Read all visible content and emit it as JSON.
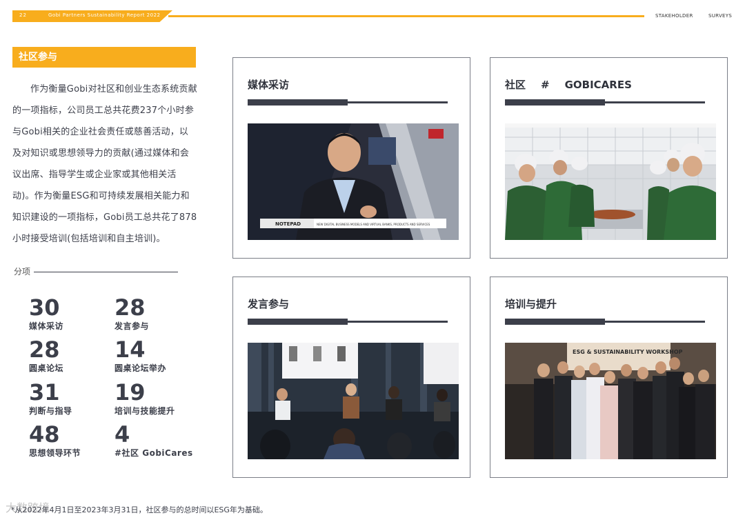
{
  "header": {
    "page_number": "22",
    "report_title": "Gobi Partners  Sustainability Report 2022",
    "nav": [
      "STAKEHOLDER",
      "SURVEYS"
    ],
    "accent_color": "#f8ad1d"
  },
  "section": {
    "title": "社区参与",
    "intro": "作为衡量Gobi对社区和创业生态系统贡献的一项指标，公司员工总共花费237个小时参与Gobi相关的企业社会责任或慈善活动，以及对知识或思想领导力的贡献(通过媒体和会议出席、指导学生或企业家或其他相关活动)。作为衡量ESG和可持续发展相关能力和知识建设的一项指标，Gobi员工总共花了878小时接受培训(包括培训和自主培训)。",
    "breakdown_label": "分项"
  },
  "stats": [
    {
      "value": "30",
      "label": "媒体采访"
    },
    {
      "value": "28",
      "label": "发言参与"
    },
    {
      "value": "28",
      "label": "圆桌论坛"
    },
    {
      "value": "14",
      "label": "圆桌论坛举办"
    },
    {
      "value": "31",
      "label": "判断与指导"
    },
    {
      "value": "19",
      "label": "培训与技能提升"
    },
    {
      "value": "48",
      "label": "思想领导环节"
    },
    {
      "value": "4",
      "label": "#社区 GobiCares"
    }
  ],
  "cards": [
    {
      "title": "媒体采访",
      "photo_caption": "NOTEPAD",
      "photo_subcaption": "NEW DIGITAL BUSINESS MODELS AND VIRTUAL BANKS, PRODUCTS AND SERVICES"
    },
    {
      "title_parts": [
        "社区",
        "#",
        "GOBICARES"
      ]
    },
    {
      "title": "发言参与"
    },
    {
      "title": "培训与提升",
      "photo_banner": "ESG & SUSTAINABILITY WORKSHOP"
    }
  ],
  "footer": {
    "note": "*从2022年4月1日至2023年3月31日，社区参与的总时间以ESG年为基础。",
    "watermark": "大数跨境"
  }
}
